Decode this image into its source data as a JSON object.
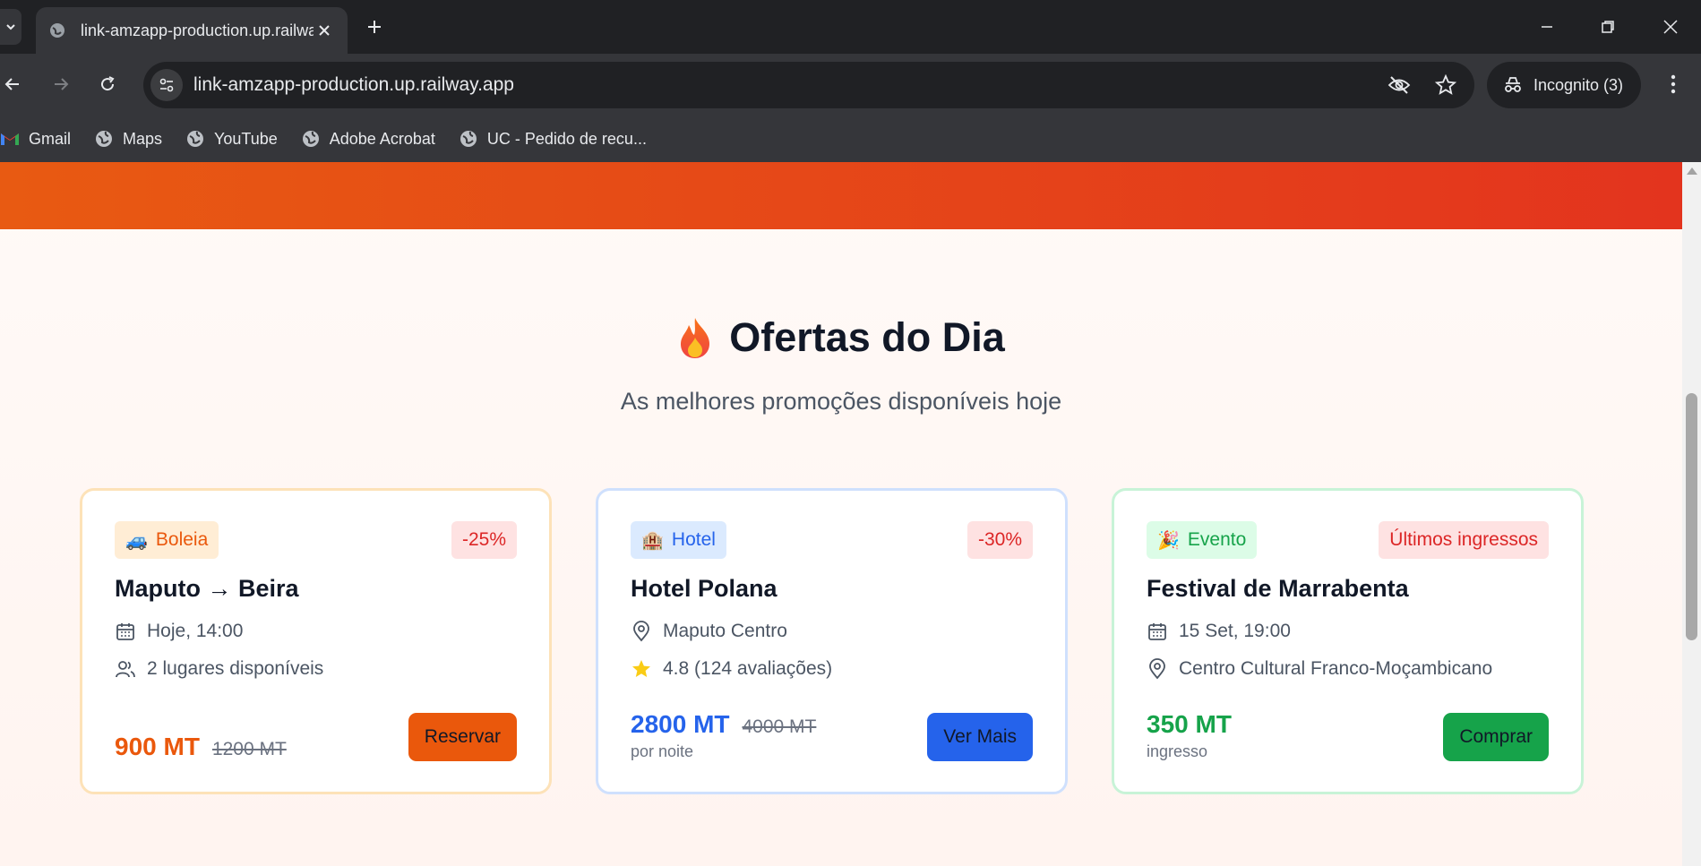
{
  "browser": {
    "tab_title": "link-amzapp-production.up.railway.app",
    "url": "link-amzapp-production.up.railway.app",
    "incognito_label": "Incognito (3)",
    "bookmarks": [
      {
        "label": "Gmail",
        "icon": "gmail-icon"
      },
      {
        "label": "Maps",
        "icon": "globe-icon"
      },
      {
        "label": "YouTube",
        "icon": "globe-icon"
      },
      {
        "label": "Adobe Acrobat",
        "icon": "globe-icon"
      },
      {
        "label": "UC - Pedido de recu...",
        "icon": "globe-icon"
      }
    ]
  },
  "section": {
    "icon": "fire-icon",
    "title": "Ofertas do Dia",
    "subtitle": "As melhores promoções disponíveis hoje"
  },
  "offers": [
    {
      "category": "Boleia",
      "category_icon": "🚙",
      "badge": "-25%",
      "title": "Maputo → Beira",
      "meta1": "Hoje, 14:00",
      "meta1_icon": "calendar-icon",
      "meta2": "2 lugares disponíveis",
      "meta2_icon": "users-icon",
      "price": "900 MT",
      "old_price": "1200 MT",
      "price_unit": "",
      "button": "Reservar",
      "accent": "#ea580c"
    },
    {
      "category": "Hotel",
      "category_icon": "🏨",
      "badge": "-30%",
      "title": "Hotel Polana",
      "meta1": "Maputo Centro",
      "meta1_icon": "map-pin-icon",
      "meta2": "4.8 (124 avaliações)",
      "meta2_icon": "star-icon",
      "price": "2800 MT",
      "old_price": "4000 MT",
      "price_unit": "por noite",
      "button": "Ver Mais",
      "accent": "#2563eb"
    },
    {
      "category": "Evento",
      "category_icon": "🎉",
      "badge": "Últimos ingressos",
      "title": "Festival de Marrabenta",
      "meta1": "15 Set, 19:00",
      "meta1_icon": "calendar-icon",
      "meta2": "Centro Cultural Franco-Moçambicano",
      "meta2_icon": "map-pin-icon",
      "price": "350 MT",
      "old_price": "",
      "price_unit": "ingresso",
      "button": "Comprar",
      "accent": "#16a34a"
    }
  ],
  "colors": {
    "hero_gradient_start": "#e85a12",
    "hero_gradient_end": "#e3341e",
    "boleia": "#ea580c",
    "hotel": "#2563eb",
    "evento": "#16a34a",
    "discount": "#dc2626"
  }
}
